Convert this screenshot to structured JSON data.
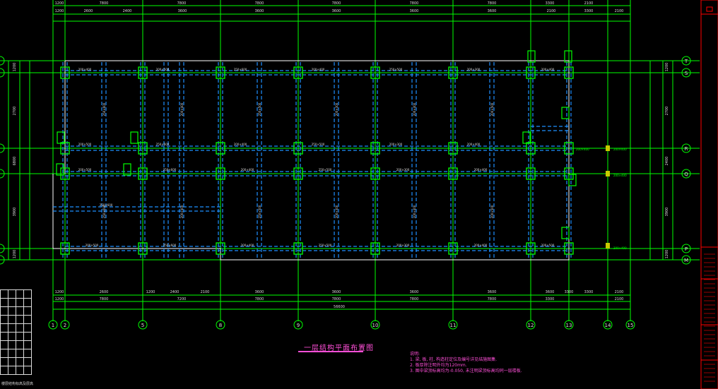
{
  "drawing": {
    "title": "一层结构平面布置图",
    "notes": {
      "heading": "说明:",
      "lines": [
        "1. 梁, 板, 柱, 构造柱定位及编号详见结施图集.",
        "2. 板厚除注明外均为120mm.",
        "3. 图中梁顶标高均为-0.050, 未注明梁顶标高均同一层楼板."
      ]
    }
  },
  "colors": {
    "background": "#000000",
    "grid": "#00ff00",
    "beam_dashed": "#1e90ff",
    "slab_outline": "#ffffff",
    "column": "#00ff00",
    "text_magenta": "#ff4fd8",
    "title_block": "#ff0000",
    "column_yellow": "#c8c800"
  },
  "axes": {
    "bottom_labels": [
      "1",
      "2",
      "5",
      "8",
      "9",
      "10",
      "11",
      "12",
      "13",
      "14",
      "15"
    ],
    "right_labels": [
      "T",
      "S",
      "R",
      "Q",
      "P",
      "M"
    ],
    "left_labels": [
      "T",
      "S",
      "R",
      "Q",
      "P",
      "M"
    ]
  },
  "dimensions": {
    "bottom_total": "56600",
    "bottom_row1": [
      "1200",
      "2600",
      "1200",
      "2400",
      "2100",
      "3600",
      "3600",
      "3600",
      "3600",
      "3600",
      "3300",
      "3300",
      "2100"
    ],
    "bottom_row2": [
      "1200",
      "7800",
      "7200",
      "7800",
      "7800",
      "7800",
      "7800",
      "3300",
      "2100"
    ],
    "top_row1": [
      "1200",
      "2600",
      "2400",
      "3600",
      "3600",
      "3600",
      "3600",
      "3600",
      "2100",
      "3300",
      "2100"
    ],
    "top_row2": [
      "1200",
      "7800",
      "7800",
      "7800",
      "7800",
      "7800",
      "7800",
      "3300",
      "2100"
    ],
    "right_row": [
      "1200",
      "2700",
      "2400",
      "3900",
      "1200"
    ],
    "left_row": [
      "1200",
      "2700",
      "6800",
      "3900",
      "1200"
    ]
  },
  "beam_labels": [
    "200×400",
    "200×500",
    "250×600",
    "200×400",
    "250×500",
    "200×300"
  ],
  "legend": {
    "caption": "楼层结构标高及层高",
    "rows": 10
  }
}
